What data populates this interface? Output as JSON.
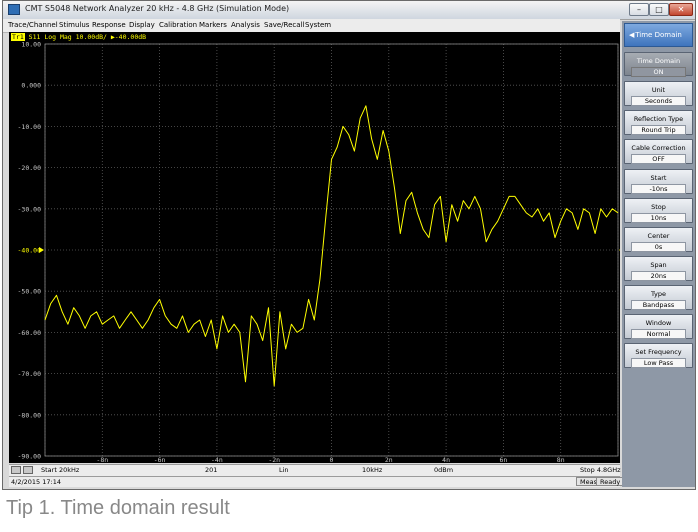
{
  "window": {
    "title": "CMT     S5048     Network Analyzer     20 kHz - 4.8 GHz     (Simulation Mode)",
    "minimize_label": "–",
    "maximize_label": "□",
    "close_label": "✕"
  },
  "menu": [
    "Trace/Channel",
    "Stimulus",
    "Response",
    "Display",
    "Calibration",
    "Markers",
    "Analysis",
    "Save/Recall",
    "System"
  ],
  "trace": {
    "badge": "Tr1",
    "text": " S11 Log Mag 10.00dB/ ",
    "ref_marker": "▶",
    "ref_value": "-40.00dB",
    "color": "#ffff00"
  },
  "chart_data": {
    "type": "line",
    "x_ticks": [
      "-8n",
      "-6n",
      "-4n",
      "-2n",
      "0",
      "2n",
      "4n",
      "6n",
      "8n"
    ],
    "y_ticks": [
      "10.00",
      "0.000",
      "-10.00",
      "-20.00",
      "-30.00",
      "-40.00",
      "-50.00",
      "-60.00",
      "-70.00",
      "-80.00",
      "-90.00"
    ],
    "xlim": [
      -10,
      10
    ],
    "ylim": [
      -90,
      10
    ],
    "ref_level": -40,
    "grid": true,
    "trace_color": "#ffff00",
    "series": [
      {
        "x": [
          -10,
          -9.8,
          -9.6,
          -9.4,
          -9.2,
          -9.0,
          -8.8,
          -8.6,
          -8.4,
          -8.2,
          -8.0,
          -7.8,
          -7.6,
          -7.4,
          -7.2,
          -7.0,
          -6.8,
          -6.6,
          -6.4,
          -6.2,
          -6.0,
          -5.8,
          -5.6,
          -5.4,
          -5.2,
          -5.0,
          -4.8,
          -4.6,
          -4.4,
          -4.2,
          -4.0,
          -3.8,
          -3.6,
          -3.4,
          -3.2,
          -3.0,
          -2.8,
          -2.6,
          -2.4,
          -2.2,
          -2.0,
          -1.8,
          -1.6,
          -1.4,
          -1.2,
          -1.0,
          -0.8,
          -0.6,
          -0.4,
          -0.2,
          0.0,
          0.2,
          0.4,
          0.6,
          0.8,
          1.0,
          1.2,
          1.4,
          1.6,
          1.8,
          2.0,
          2.2,
          2.4,
          2.6,
          2.8,
          3.0,
          3.2,
          3.4,
          3.6,
          3.8,
          4.0,
          4.2,
          4.4,
          4.6,
          4.8,
          5.0,
          5.2,
          5.4,
          5.6,
          5.8,
          6.0,
          6.2,
          6.4,
          6.6,
          6.8,
          7.0,
          7.2,
          7.4,
          7.6,
          7.8,
          8.0,
          8.2,
          8.4,
          8.6,
          8.8,
          9.0,
          9.2,
          9.4,
          9.6,
          9.8,
          10.0
        ],
        "values": [
          -57,
          -53,
          -51,
          -55,
          -58,
          -54,
          -56,
          -59,
          -56,
          -55,
          -58,
          -57,
          -56,
          -59,
          -57,
          -55,
          -57,
          -59,
          -57,
          -54,
          -52,
          -56,
          -58,
          -59,
          -56,
          -60,
          -58,
          -57,
          -61,
          -57,
          -64,
          -56,
          -60,
          -58,
          -60,
          -72,
          -56,
          -58,
          -62,
          -54,
          -73,
          -55,
          -64,
          -58,
          -60,
          -59,
          -52,
          -57,
          -47,
          -32,
          -18,
          -15,
          -10,
          -12,
          -16,
          -8,
          -5,
          -13,
          -18,
          -11,
          -16,
          -25,
          -36,
          -28,
          -26,
          -31,
          -35,
          -37,
          -29,
          -27,
          -38,
          -29,
          -33,
          -28,
          -30,
          -27,
          -30,
          -38,
          -35,
          -33,
          -30,
          -27,
          -27,
          -29,
          -31,
          -32,
          -30,
          -33,
          -31,
          -37,
          -33,
          -30,
          -31,
          -35,
          -30,
          -31,
          -36,
          -30,
          -32,
          -30,
          -31
        ]
      }
    ]
  },
  "status1": {
    "start": "Start  20kHz",
    "points": "201",
    "sweep_type": "Lin",
    "ifbw": "10kHz",
    "power": "0dBm",
    "stop": "Stop  4.8GHz"
  },
  "status2": {
    "datetime": "4/2/2015 17:14",
    "meas": "Meas",
    "ready": "Ready"
  },
  "softkeys": {
    "header": "Time Domain",
    "header_arrow": "◀",
    "items": [
      {
        "label": "Time Domain",
        "value": "ON"
      },
      {
        "label": "Unit",
        "value": "Seconds"
      },
      {
        "label": "Reflection Type",
        "value": "Round Trip"
      },
      {
        "label": "Cable Correction",
        "value": "OFF"
      },
      {
        "label": "Start",
        "value": "-10ns"
      },
      {
        "label": "Stop",
        "value": "10ns"
      },
      {
        "label": "Center",
        "value": "0s"
      },
      {
        "label": "Span",
        "value": "20ns"
      },
      {
        "label": "Type",
        "value": "Bandpass"
      },
      {
        "label": "Window",
        "value": "Normal"
      },
      {
        "label": "Set Frequency",
        "value": "Low Pass"
      }
    ]
  },
  "caption": "Tip 1. Time domain result"
}
